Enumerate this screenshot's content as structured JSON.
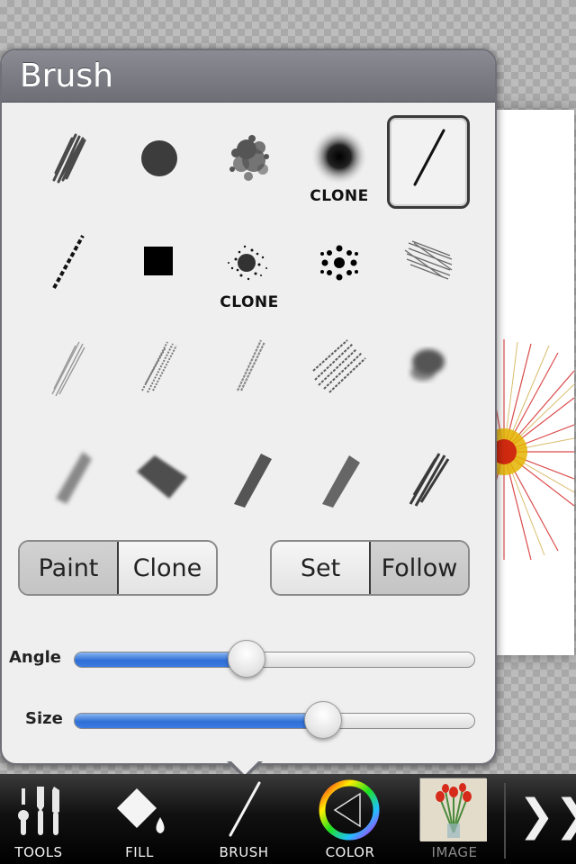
{
  "popover": {
    "title": "Brush"
  },
  "brushes": {
    "clone_label": "CLONE",
    "rows": [
      [
        "chalk-brush-icon",
        "round-brush-icon",
        "splatter-brush-icon",
        "soft-clone-brush-icon",
        "line-brush-icon"
      ],
      [
        "dashed-line-brush-icon",
        "square-brush-icon",
        "spray-clone-brush-icon",
        "dots-brush-icon",
        "hatch-brush-icon"
      ],
      [
        "pencil-hatch-icon",
        "charcoal-brush-icon",
        "pencil-stroke-icon",
        "crayon-brush-icon",
        "smudge-brush-icon"
      ],
      [
        "watercolor-brush-icon",
        "ink-wash-brush-icon",
        "dry-brush-icon",
        "sumi-brush-icon",
        "bristle-brush-icon"
      ]
    ],
    "selected": "line-brush-icon"
  },
  "mode_toggle": {
    "paint_label": "Paint",
    "clone_label": "Clone",
    "selected": "Paint"
  },
  "angle_toggle": {
    "set_label": "Set",
    "follow_label": "Follow",
    "selected": "Follow"
  },
  "sliders": {
    "angle": {
      "label": "Angle",
      "value": 0.43
    },
    "size": {
      "label": "Size",
      "value": 0.62
    }
  },
  "toolbar": {
    "tools_label": "TOOLS",
    "fill_label": "FILL",
    "brush_label": "BRUSH",
    "color_label": "COLOR",
    "image_label": "IMAGE",
    "more_label": "❯❯"
  },
  "colors": {
    "accent_blue": "#2f6fd6",
    "popover_header": "#7a7b83",
    "toolbar_bg": "#111111"
  }
}
